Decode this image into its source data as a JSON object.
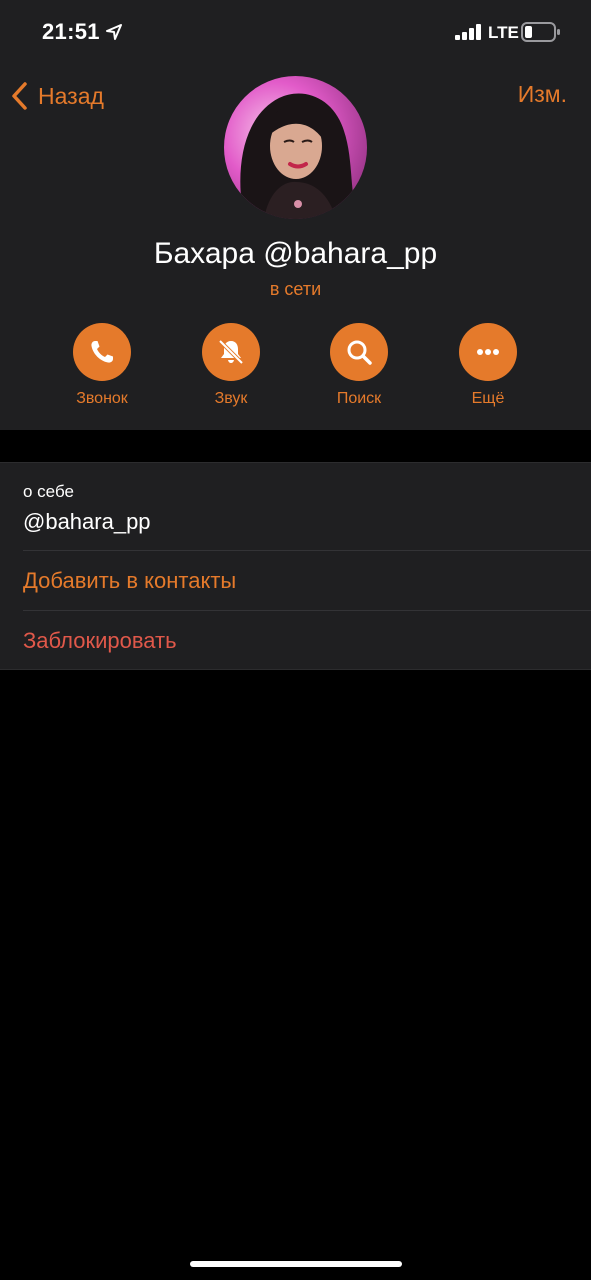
{
  "status_bar": {
    "time": "21:51",
    "network": "LTE",
    "location_icon": "location-arrow-icon",
    "signal_icon": "signal-bars-icon",
    "battery_icon": "battery-icon",
    "battery_level": 0.25
  },
  "nav": {
    "back_label": "Назад",
    "edit_label": "Изм."
  },
  "profile": {
    "name": "Бахара @bahara_pp",
    "status": "в сети",
    "avatar_icon": "profile-photo"
  },
  "actions": [
    {
      "label": "Звонок",
      "icon": "phone-icon"
    },
    {
      "label": "Звук",
      "icon": "bell-muted-icon"
    },
    {
      "label": "Поиск",
      "icon": "search-icon"
    },
    {
      "label": "Ещё",
      "icon": "more-icon"
    }
  ],
  "info": {
    "bio_label": "о себе",
    "bio_value": "@bahara_pp",
    "add_contact_label": "Добавить в контакты",
    "block_label": "Заблокировать"
  },
  "colors": {
    "accent": "#e57a2b",
    "danger": "#e0584a",
    "panel_bg": "#1f1f21",
    "page_bg": "#000000"
  }
}
